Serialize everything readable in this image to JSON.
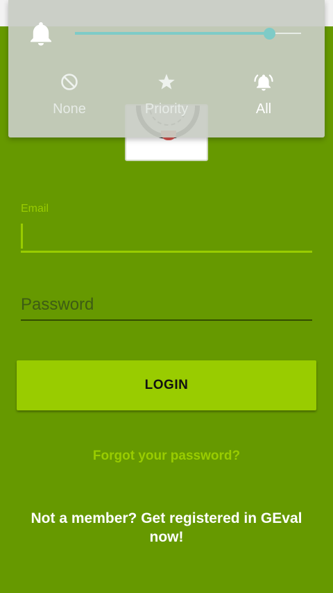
{
  "overlay": {
    "volume_level": 0.86,
    "modes": [
      {
        "label": "None",
        "icon": "block-icon",
        "active": false
      },
      {
        "label": "Priority",
        "icon": "star-icon",
        "active": false
      },
      {
        "label": "All",
        "icon": "bell-ring-icon",
        "active": true
      }
    ]
  },
  "form": {
    "email_label": "Email",
    "email_value": "",
    "password_placeholder": "Password",
    "login_label": "LOGIN",
    "forgot_link": "Forgot your password?",
    "register_text": "Not a member? Get registered in GEval now!"
  },
  "colors": {
    "background": "#669900",
    "accent": "#99cc00",
    "slider": "#7ecbc7"
  }
}
